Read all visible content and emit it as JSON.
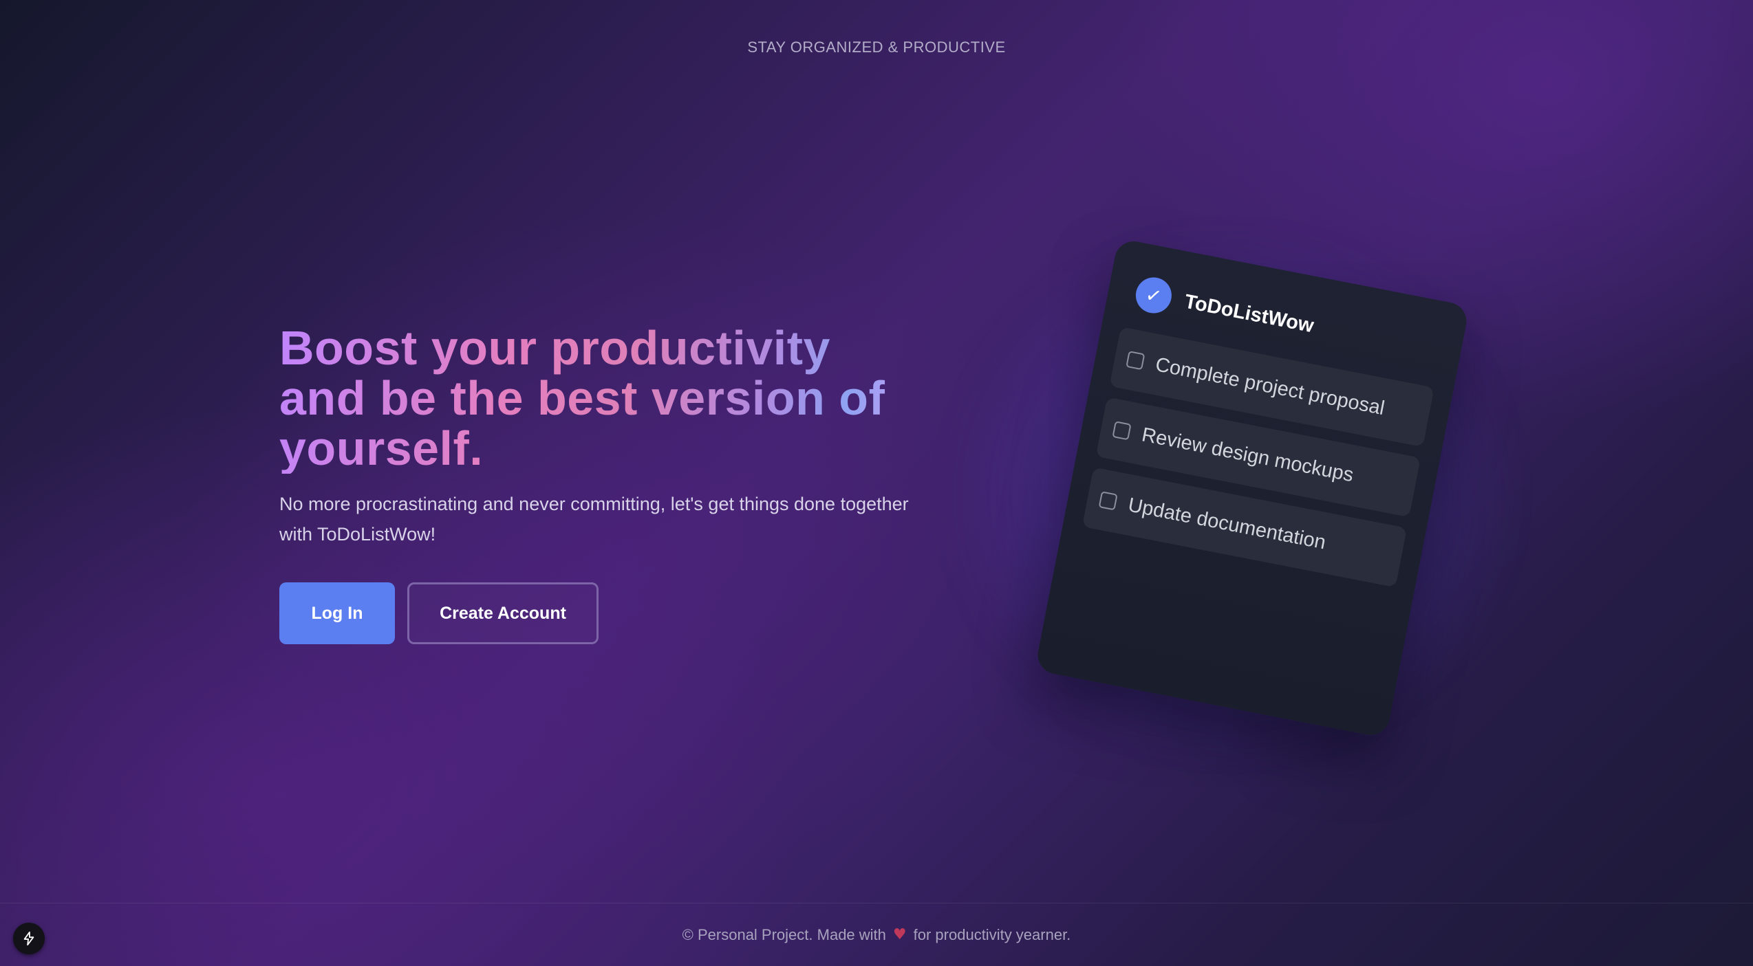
{
  "tagline": "STAY ORGANIZED & PRODUCTIVE",
  "hero": {
    "headline": "Boost your productivity and be the best version of yourself.",
    "subtext": "No more procrastinating and never committing, let's get things done together with ToDoListWow!",
    "login_label": "Log In",
    "create_account_label": "Create Account"
  },
  "preview_card": {
    "app_name": "ToDoListWow",
    "badge_icon": "checkmark-icon",
    "tasks": [
      {
        "label": "Complete project proposal",
        "checked": false
      },
      {
        "label": "Review design mockups",
        "checked": false
      },
      {
        "label": "Update documentation",
        "checked": false
      }
    ]
  },
  "footer": {
    "text_before": "© Personal Project. Made with",
    "heart_icon": "heart-icon",
    "text_after": "for productivity yearner."
  },
  "corner_button": {
    "icon": "lightning-bolt-icon"
  },
  "colors": {
    "primary": "#5b7ff0",
    "outline_border": "#7d64a8",
    "card_bg": "#1e2232",
    "task_bg": "#2a2e3c",
    "heart": "#c0395a"
  }
}
